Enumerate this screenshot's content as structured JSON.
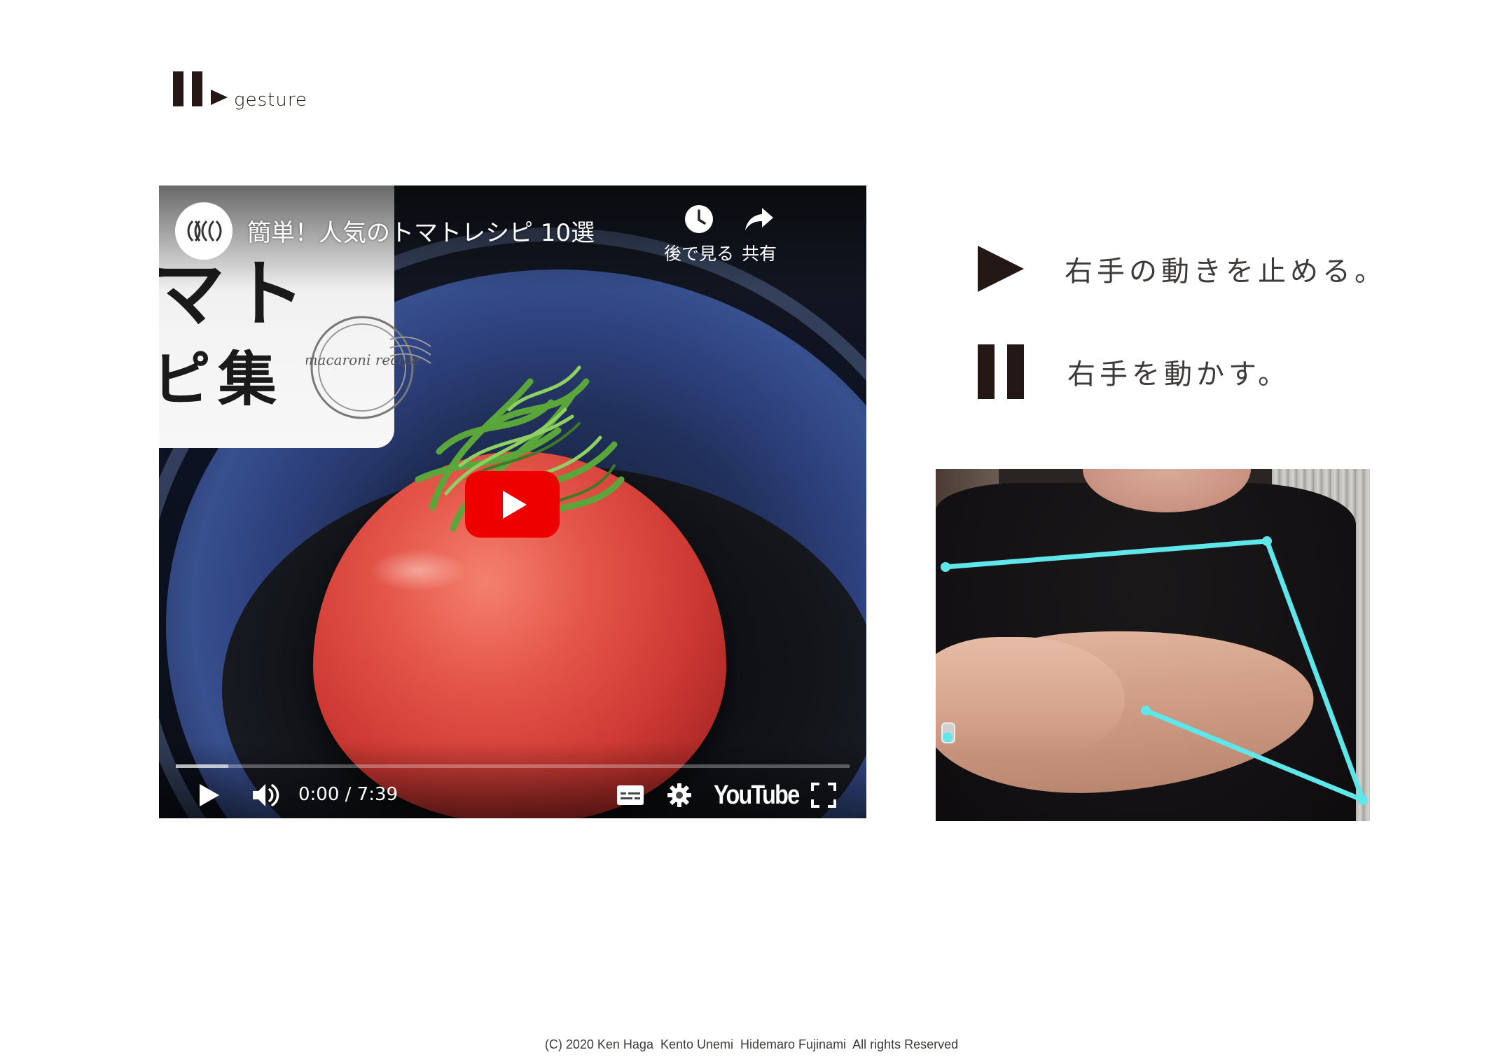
{
  "header": {
    "logo_word": "gesture",
    "logo_icons": [
      "pause-icon",
      "play-icon"
    ]
  },
  "video": {
    "title": "簡単！人気のトマトレシピ 10選",
    "channel_avatar_text": "ⅢⅢ",
    "card_text_line1": "マト",
    "card_text_line2": "ピ集",
    "stamp_text": "macaroni recipe",
    "watch_later_label": "後で見る",
    "share_label": "共有",
    "time_display": "0:00 / 7:39",
    "progress_loaded_fraction": 0.078,
    "brand_logo": "YouTube",
    "icons": [
      "channel-avatar-icon",
      "clock-icon",
      "share-arrow-icon",
      "big-play-icon",
      "play-icon",
      "volume-icon",
      "subtitles-icon",
      "gear-icon",
      "fullscreen-icon"
    ],
    "colors": {
      "play_button": "#ee0000",
      "control_text": "#ffffff"
    }
  },
  "instructions": [
    {
      "icon": "play-icon",
      "text": "右手の動きを止める。"
    },
    {
      "icon": "pause-icon",
      "text": "右手を動かす。"
    }
  ],
  "webcam": {
    "skeleton_color": "#5ee6ea"
  },
  "footer": {
    "copyright": "(C) 2020 Ken Haga  Kento Unemi  Hidemaro Fujinami  All rights Reserved"
  }
}
